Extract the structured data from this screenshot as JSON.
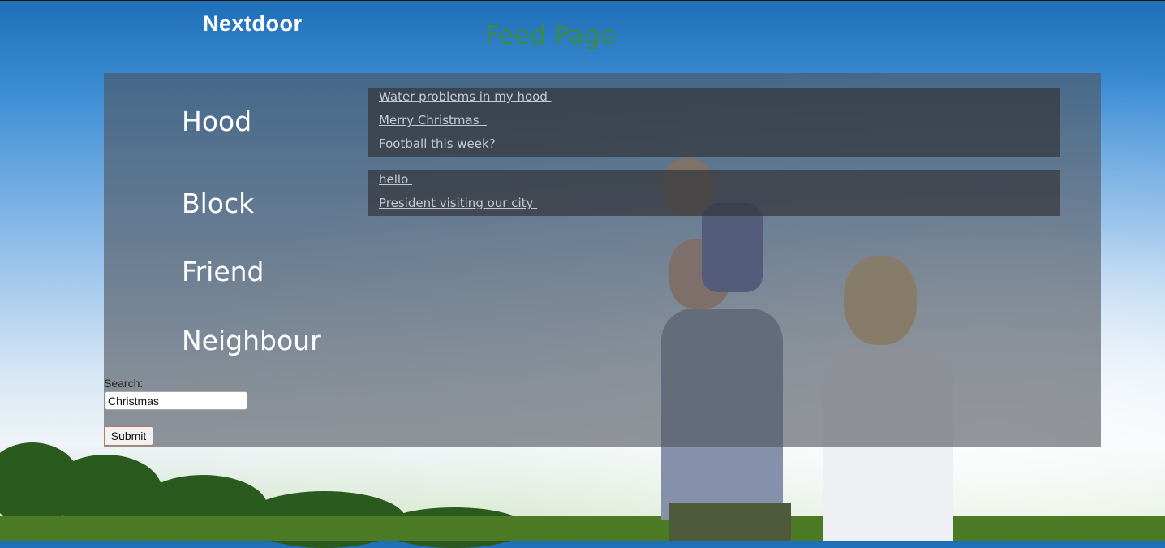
{
  "header": {
    "brand": "Nextdoor",
    "title": "Feed Page"
  },
  "sidebar": {
    "items": [
      {
        "label": "Hood"
      },
      {
        "label": "Block"
      },
      {
        "label": "Friend"
      },
      {
        "label": "Neighbour"
      }
    ]
  },
  "feeds": {
    "hood": [
      "Water problems in my hood ",
      "Merry Christmas  ",
      "Football this week?"
    ],
    "block": [
      "hello ",
      "President visiting our city "
    ]
  },
  "search": {
    "label": "Search:",
    "value": "Christmas",
    "submit_label": "Submit"
  }
}
